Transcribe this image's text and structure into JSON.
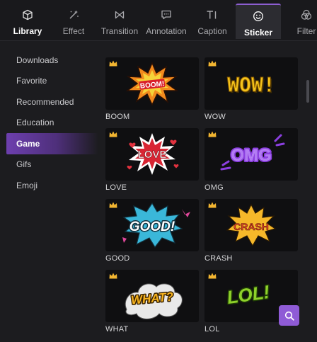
{
  "tabs": [
    {
      "label": "Library",
      "icon": "cube-icon"
    },
    {
      "label": "Effect",
      "icon": "magic-wand-icon"
    },
    {
      "label": "Transition",
      "icon": "transition-bowtie-icon"
    },
    {
      "label": "Annotation",
      "icon": "speech-bubble-icon"
    },
    {
      "label": "Caption",
      "icon": "text-caption-icon"
    },
    {
      "label": "Sticker",
      "icon": "smiley-icon",
      "active": true
    },
    {
      "label": "Filter",
      "icon": "filter-circles-icon"
    }
  ],
  "sidebar": {
    "items": [
      {
        "label": "Downloads"
      },
      {
        "label": "Favorite"
      },
      {
        "label": "Recommended"
      },
      {
        "label": "Education"
      },
      {
        "label": "Game",
        "active": true
      },
      {
        "label": "Gifs"
      },
      {
        "label": "Emoji"
      }
    ]
  },
  "stickers": [
    {
      "caption": "BOOM",
      "art_text": "BOOM!",
      "premium": true
    },
    {
      "caption": "WOW",
      "art_text": "WOW!",
      "premium": true
    },
    {
      "caption": "LOVE",
      "art_text": "LOVE",
      "premium": true
    },
    {
      "caption": "OMG",
      "art_text": "OMG",
      "premium": true
    },
    {
      "caption": "GOOD",
      "art_text": "GOOD!",
      "premium": true
    },
    {
      "caption": "CRASH",
      "art_text": "CRASH",
      "premium": true
    },
    {
      "caption": "WHAT",
      "art_text": "WHAT?",
      "premium": true
    },
    {
      "caption": "LOL",
      "art_text": "LOL!",
      "premium": true
    }
  ],
  "colors": {
    "accent": "#8f5bd6",
    "crown": "#f2b531",
    "background": "#1c1c1f"
  },
  "search_button": {
    "icon": "search-icon"
  }
}
